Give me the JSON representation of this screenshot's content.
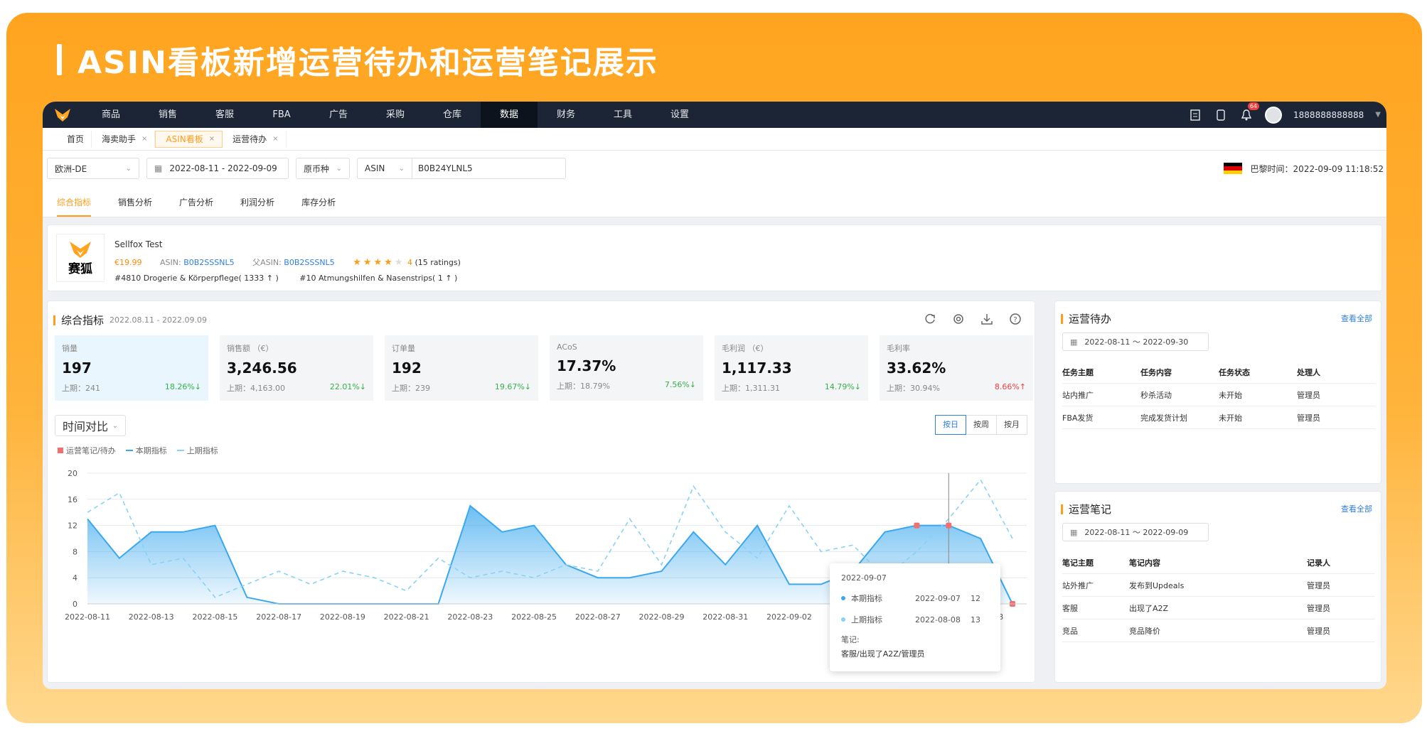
{
  "banner": {
    "title": "ASIN看板新增运营待办和运营笔记展示"
  },
  "topnav": {
    "items": [
      "商品",
      "销售",
      "客服",
      "FBA",
      "广告",
      "采购",
      "仓库",
      "数据",
      "财务",
      "工具",
      "设置"
    ],
    "active": "数据",
    "notification_count": "64",
    "username": "1888888888888"
  },
  "page_tabs": [
    {
      "label": "首页",
      "closable": false
    },
    {
      "label": "海卖助手",
      "closable": true
    },
    {
      "label": "ASIN看板",
      "closable": true,
      "active": true
    },
    {
      "label": "运营待办",
      "closable": true
    }
  ],
  "filters": {
    "store": "欧洲-DE",
    "date_range": "2022-08-11 - 2022-09-09",
    "currency": "原币种",
    "search_type": "ASIN",
    "search_value": "B0B24YLNL5",
    "time_label": "巴黎时间：2022-09-09 11:18:52"
  },
  "sub_tabs": [
    "综合指标",
    "销售分析",
    "广告分析",
    "利润分析",
    "库存分析"
  ],
  "product": {
    "logo_text": "赛狐",
    "name": "Sellfox Test",
    "price": "€19.99",
    "asin_label": "ASIN:",
    "asin": "B0B2SSSNL5",
    "parent_asin_label": "父ASIN:",
    "parent_asin": "B0B2SSSNL5",
    "rating": 4,
    "rating_text": "4",
    "ratings_count": "(15 ratings)",
    "rank1": "#4810 Drogerie & Körperpflege( 1333 ↑ )",
    "rank2": "#10 Atmungshilfen & Nasenstrips( 1 ↑ )"
  },
  "overview": {
    "title": "综合指标",
    "date": "2022.08.11 - 2022.09.09",
    "metrics": [
      {
        "label": "销量",
        "value": "197",
        "prev": "上期：241",
        "change": "18.26%↓",
        "trend": "down"
      },
      {
        "label": "销售额 （€）",
        "value": "3,246.56",
        "prev": "上期：4,163.00",
        "change": "22.01%↓",
        "trend": "down"
      },
      {
        "label": "订单量",
        "value": "192",
        "prev": "上期：239",
        "change": "19.67%↓",
        "trend": "down"
      },
      {
        "label": "ACoS",
        "value": "17.37%",
        "prev": "上期：18.79%",
        "change": "7.56%↓",
        "trend": "down"
      },
      {
        "label": "毛利润 （€）",
        "value": "1,117.33",
        "prev": "上期：1,311.31",
        "change": "14.79%↓",
        "trend": "down"
      },
      {
        "label": "毛利率",
        "value": "33.62%",
        "prev": "上期：30.94%",
        "change": "8.66%↑",
        "trend": "up"
      }
    ],
    "compare_select": "时间对比",
    "granularity": [
      "按日",
      "按周",
      "按月"
    ],
    "granularity_active": "按日",
    "legend": [
      "运营笔记/待办",
      "本期指标",
      "上期指标"
    ]
  },
  "colors": {
    "accent": "#ff9c1a",
    "current": "#3aa8ee",
    "previous": "#8ad2f2",
    "note_marker": "#f07070"
  },
  "chart_data": {
    "type": "area",
    "x": [
      "2022-08-11",
      "2022-08-12",
      "2022-08-13",
      "2022-08-14",
      "2022-08-15",
      "2022-08-16",
      "2022-08-17",
      "2022-08-18",
      "2022-08-19",
      "2022-08-20",
      "2022-08-21",
      "2022-08-22",
      "2022-08-23",
      "2022-08-24",
      "2022-08-25",
      "2022-08-26",
      "2022-08-27",
      "2022-08-28",
      "2022-08-29",
      "2022-08-30",
      "2022-08-31",
      "2022-09-01",
      "2022-09-02",
      "2022-09-03",
      "2022-09-04",
      "2022-09-05",
      "2022-09-06",
      "2022-09-07",
      "2022-09-08",
      "2022-09-09"
    ],
    "x_tick_labels": [
      "2022-08-11",
      "2022-08-13",
      "2022-08-15",
      "2022-08-17",
      "2022-08-19",
      "2022-08-21",
      "2022-08-23",
      "2022-08-25",
      "2022-08-27",
      "2022-08-29",
      "2022-08-31",
      "2022-09-02",
      "2022-09-04",
      "2022-09-06",
      "2022-09-08"
    ],
    "series": [
      {
        "name": "本期指标",
        "values": [
          13,
          7,
          11,
          11,
          12,
          1,
          0,
          0,
          0,
          0,
          0,
          0,
          15,
          11,
          12,
          6,
          4,
          4,
          5,
          11,
          6,
          12,
          3,
          3,
          5,
          11,
          12,
          12,
          10,
          0
        ]
      },
      {
        "name": "上期指标",
        "values": [
          14,
          17,
          6,
          7,
          1,
          3,
          5,
          3,
          5,
          4,
          2,
          7,
          4,
          5,
          4,
          6,
          5,
          13,
          6,
          18,
          11,
          7,
          15,
          8,
          9,
          4,
          8,
          13,
          19,
          10
        ]
      }
    ],
    "note_markers_x": [
      "2022-09-06",
      "2022-09-07",
      "2022-09-09"
    ],
    "ylim": [
      0,
      20
    ],
    "y_ticks": [
      0,
      4,
      8,
      12,
      16,
      20
    ],
    "grid": true,
    "legend_position": "top-left"
  },
  "tooltip": {
    "date": "2022-09-07",
    "current_label": "本期指标",
    "current_date": "2022-09-07",
    "current_value": "12",
    "previous_label": "上期指标",
    "previous_date": "2022-08-08",
    "previous_value": "13",
    "note_label": "笔记:",
    "note_text": "客服/出现了A2Z/管理员"
  },
  "todo": {
    "title": "运营待办",
    "view_all": "查看全部",
    "date_range": "2022-08-11 ～ 2022-09-30",
    "columns": [
      "任务主题",
      "任务内容",
      "任务状态",
      "处理人"
    ],
    "rows": [
      [
        "站内推广",
        "秒杀活动",
        "未开始",
        "管理员"
      ],
      [
        "FBA发货",
        "完成发货计划",
        "未开始",
        "管理员"
      ]
    ]
  },
  "notes": {
    "title": "运营笔记",
    "view_all": "查看全部",
    "date_range": "2022-08-11 ～ 2022-09-09",
    "columns": [
      "笔记主题",
      "笔记内容",
      "记录人"
    ],
    "rows": [
      [
        "站外推广",
        "发布到Updeals",
        "管理员"
      ],
      [
        "客服",
        "出现了A2Z",
        "管理员"
      ],
      [
        "竞品",
        "竞品降价",
        "管理员"
      ]
    ]
  }
}
